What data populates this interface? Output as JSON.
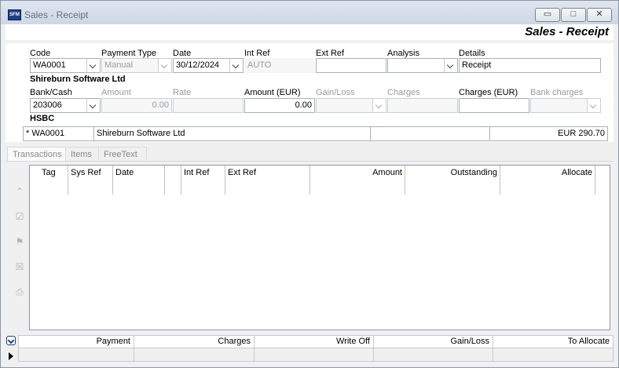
{
  "window": {
    "title": "Sales - Receipt",
    "app_icon_text": "SFM",
    "minimize_glyph": "▭",
    "maximize_glyph": "□",
    "close_glyph": "✕"
  },
  "banner": {
    "title": "Sales - Receipt"
  },
  "form": {
    "code": {
      "label": "Code",
      "value": "WA0001"
    },
    "payment_type": {
      "label": "Payment Type",
      "value": "Manual"
    },
    "date": {
      "label": "Date",
      "value": "30/12/2024"
    },
    "int_ref": {
      "label": "Int Ref",
      "value": "AUTO"
    },
    "ext_ref": {
      "label": "Ext Ref",
      "value": ""
    },
    "analysis": {
      "label": "Analysis",
      "value": ""
    },
    "details": {
      "label": "Details",
      "value": "Receipt"
    },
    "customer_name": "Shireburn Software Ltd",
    "bank_cash": {
      "label": "Bank/Cash",
      "value": "203006"
    },
    "amount": {
      "label": "Amount",
      "value": "0.00"
    },
    "rate": {
      "label": "Rate",
      "value": ""
    },
    "amount_eur": {
      "label": "Amount (EUR)",
      "value": "0.00"
    },
    "gain_loss": {
      "label": "Gain/Loss",
      "value": ""
    },
    "charges": {
      "label": "Charges",
      "value": ""
    },
    "charges_eur": {
      "label": "Charges (EUR)",
      "value": ""
    },
    "bank_charges": {
      "label": "Bank charges",
      "value": ""
    },
    "bank_name": "HSBC"
  },
  "account_row": {
    "marker": "*",
    "code": "WA0001",
    "name": "Shireburn Software Ltd",
    "extra": "",
    "balance": "EUR 290.70"
  },
  "tabs": [
    {
      "label": "Transactions"
    },
    {
      "label": "Items"
    },
    {
      "label": "FreeText"
    }
  ],
  "side_icons": [
    "chevron-up-icon",
    "allocate-icon",
    "flag-icon",
    "unallocate-icon",
    "print-icon"
  ],
  "grid": {
    "columns": [
      "Tag",
      "Sys Ref",
      "Date",
      "",
      "Int Ref",
      "Ext Ref",
      "Amount",
      "Outstanding",
      "Allocate"
    ]
  },
  "totals": {
    "columns": [
      "Payment",
      "Charges",
      "Write Off",
      "Gain/Loss",
      "To Allocate"
    ]
  }
}
